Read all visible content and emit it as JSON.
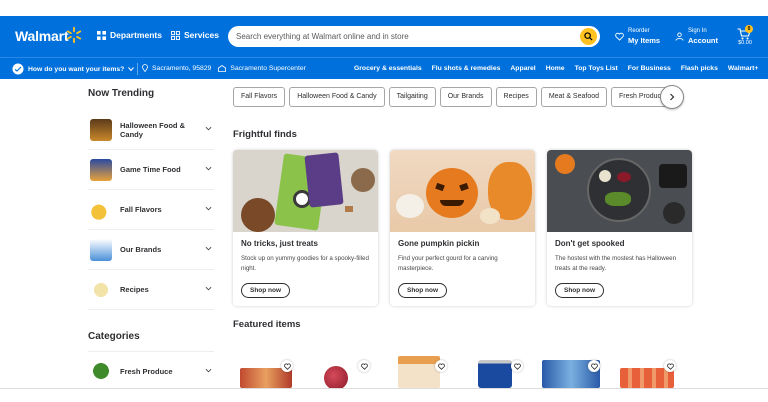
{
  "header": {
    "brand": "Walmart",
    "departments": "Departments",
    "services": "Services",
    "search_placeholder": "Search everything at Walmart online and in store",
    "reorder_small": "Reorder",
    "reorder_big": "My Items",
    "signin_small": "Sign In",
    "signin_big": "Account",
    "cart_count": "0",
    "cart_total": "$0.00"
  },
  "subbar": {
    "question": "How do you want your items?",
    "zip": "Sacramento, 95829",
    "store": "Sacramento Supercenter",
    "links": [
      "Grocery & essentials",
      "Flu shots & remedies",
      "Apparel",
      "Home",
      "Top Toys List",
      "For Business",
      "Flash picks",
      "Walmart+"
    ]
  },
  "sidebar": {
    "trending_title": "Now Trending",
    "trending": [
      "Halloween Food & Candy",
      "Game Time Food",
      "Fall Flavors",
      "Our Brands",
      "Recipes"
    ],
    "categories_title": "Categories",
    "categories": [
      "Fresh Produce"
    ]
  },
  "chips": [
    "Fall Flavors",
    "Halloween Food & Candy",
    "Tailgaiting",
    "Our Brands",
    "Recipes",
    "Meat & Seafood",
    "Fresh Produce"
  ],
  "frightful": {
    "title": "Frightful finds",
    "cards": [
      {
        "title": "No tricks, just treats",
        "desc": "Stock up on yummy goodies for a spooky-filled night.",
        "cta": "Shop now"
      },
      {
        "title": "Gone pumpkin pickin",
        "desc": "Find your perfect gourd for a carving masterpiece.",
        "cta": "Shop now"
      },
      {
        "title": "Don't get spooked",
        "desc": "The hostest with the mostest has Halloween treats at the ready.",
        "cta": "Shop now"
      }
    ]
  },
  "featured": {
    "title": "Featured items"
  },
  "colors": {
    "brand_blue": "#0071dc",
    "spark_yellow": "#ffc220"
  }
}
